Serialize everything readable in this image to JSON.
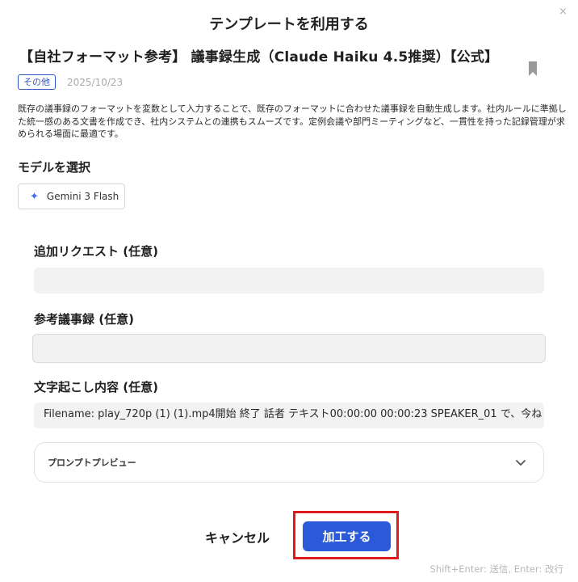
{
  "modal": {
    "title": "テンプレートを利用する",
    "close_icon": "×"
  },
  "template": {
    "title": "【自社フォーマット参考】 議事録生成（Claude Haiku 4.5推奨）【公式】",
    "category_badge": "その他",
    "date": "2025/10/23",
    "description": "既存の議事録のフォーマットを変数として入力することで、既存のフォーマットに合わせた議事録を自動生成します。社内ルールに準拠した統一感のある文書を作成でき、社内システムとの連携もスムーズです。定例会議や部門ミーティングなど、一貫性を持った記録管理が求められる場面に最適です。",
    "bookmark_icon": "bookmark-icon"
  },
  "model_section": {
    "label": "モデルを選択",
    "selected_model": "Gemini 3 Flash",
    "model_icon": "sparkle-icon"
  },
  "fields": {
    "additional_request": {
      "label": "追加リクエスト (任意)",
      "value": ""
    },
    "reference_minutes": {
      "label": "参考議事録 (任意)",
      "value": ""
    },
    "transcript": {
      "label": "文字起こし内容 (任意)",
      "value": "Filename: play_720p (1) (1).mp4開始 終了 話者 テキスト00:00:00 00:00:23 SPEAKER_01 で、今ね"
    }
  },
  "prompt_preview": {
    "label": "プロンプトプレビュー",
    "icon": "chevron-down-icon"
  },
  "actions": {
    "cancel_label": "キャンセル",
    "process_label": "加工する",
    "process_color": "#2a59d9",
    "highlight_color": "#e01b1b"
  },
  "hint": "Shift+Enter: 送信, Enter: 改行"
}
